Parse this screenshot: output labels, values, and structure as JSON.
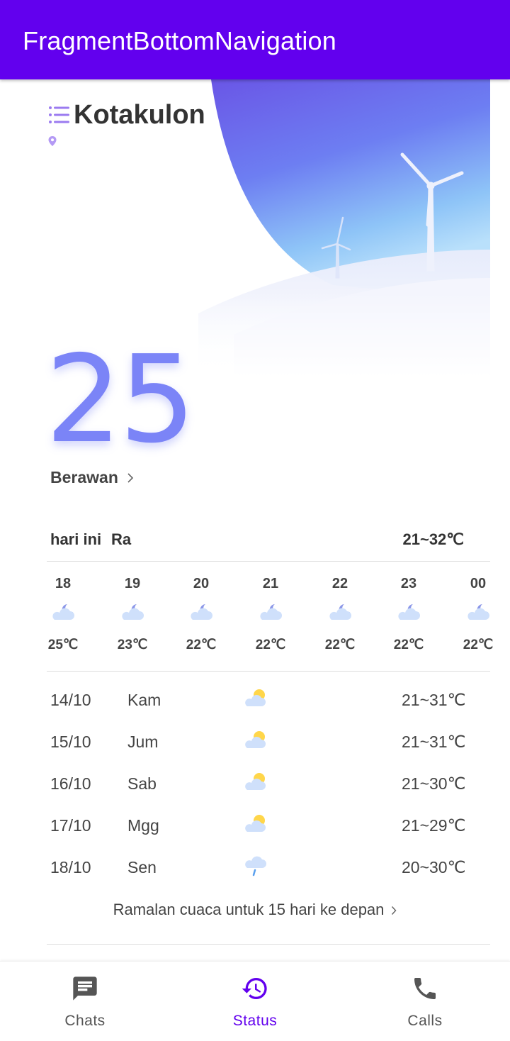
{
  "appbar": {
    "title": "FragmentBottomNavigation"
  },
  "location": {
    "city": "Kotakulon"
  },
  "current": {
    "temperature": "25",
    "condition": "Berawan"
  },
  "today": {
    "label": "hari ini",
    "condition": "Ra",
    "range": "21~32℃"
  },
  "hourly": [
    {
      "time": "18",
      "temp": "25℃",
      "icon": "cloudy-night-icon"
    },
    {
      "time": "19",
      "temp": "23℃",
      "icon": "cloudy-night-icon"
    },
    {
      "time": "20",
      "temp": "22℃",
      "icon": "cloudy-night-icon"
    },
    {
      "time": "21",
      "temp": "22℃",
      "icon": "cloudy-night-icon"
    },
    {
      "time": "22",
      "temp": "22℃",
      "icon": "cloudy-night-icon"
    },
    {
      "time": "23",
      "temp": "22℃",
      "icon": "cloudy-night-icon"
    },
    {
      "time": "00",
      "temp": "22℃",
      "icon": "cloudy-night-icon"
    }
  ],
  "daily": [
    {
      "date": "14/10",
      "day": "Kam",
      "range": "21~31℃",
      "icon": "partly-cloudy-icon"
    },
    {
      "date": "15/10",
      "day": "Jum",
      "range": "21~31℃",
      "icon": "partly-cloudy-icon"
    },
    {
      "date": "16/10",
      "day": "Sab",
      "range": "21~30℃",
      "icon": "partly-cloudy-icon"
    },
    {
      "date": "17/10",
      "day": "Mgg",
      "range": "21~29℃",
      "icon": "partly-cloudy-icon"
    },
    {
      "date": "18/10",
      "day": "Sen",
      "range": "20~30℃",
      "icon": "rain-icon"
    }
  ],
  "forecast_link": "Ramalan cuaca untuk 15 hari ke depan",
  "bottom_nav": {
    "items": [
      {
        "label": "Chats",
        "icon": "chat-icon",
        "selected": false
      },
      {
        "label": "Status",
        "icon": "history-icon",
        "selected": true
      },
      {
        "label": "Calls",
        "icon": "phone-icon",
        "selected": false
      }
    ]
  },
  "colors": {
    "primary": "#6200EE",
    "temperature": "#7B84F7",
    "nav_selected": "#6200EE",
    "nav_unselected": "#555555"
  }
}
